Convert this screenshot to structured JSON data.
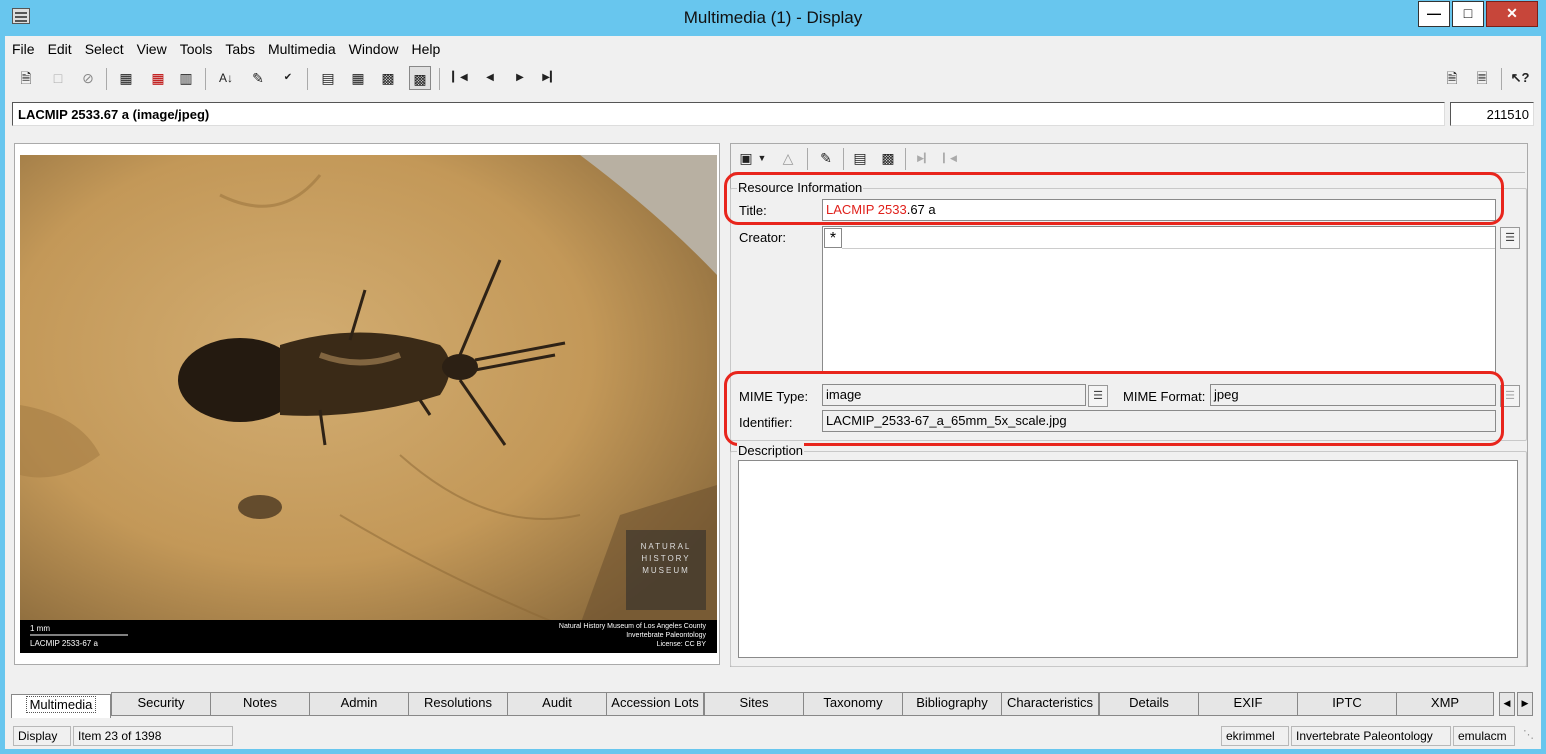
{
  "window": {
    "title": "Multimedia (1) - Display"
  },
  "menu": [
    "File",
    "Edit",
    "Select",
    "View",
    "Tools",
    "Tabs",
    "Multimedia",
    "Window",
    "Help"
  ],
  "record": {
    "summary": "LACMIP 2533.67 a (image/jpeg)",
    "id": "211510"
  },
  "image": {
    "scale_label": "1 mm",
    "caption": "LACMIP 2533-67 a",
    "credit_line1": "Natural History Museum of Los Angeles County",
    "credit_line2": "Invertebrate Paleontology",
    "credit_line3": "License: CC BY",
    "logo_text": [
      "NATURAL",
      "HISTORY",
      "MUSEUM"
    ]
  },
  "resource": {
    "group_label": "Resource Information",
    "title_label": "Title:",
    "title_highlight": "LACMIP 2533",
    "title_rest": ".67 a",
    "creator_label": "Creator:",
    "creator_marker": "*",
    "mime_type_label": "MIME Type:",
    "mime_type": "image",
    "mime_format_label": "MIME Format:",
    "mime_format": "jpeg",
    "identifier_label": "Identifier:",
    "identifier": "LACMIP_2533-67_a_65mm_5x_scale.jpg"
  },
  "description": {
    "label": "Description",
    "value": ""
  },
  "tabs": [
    "Multimedia",
    "Security",
    "Notes",
    "Admin",
    "Resolutions",
    "Audit",
    "Accession Lots",
    "Sites",
    "Taxonomy",
    "Bibliography",
    "Characteristics",
    "Details",
    "EXIF",
    "IPTC",
    "XMP"
  ],
  "active_tab": "Multimedia",
  "status": {
    "mode": "Display",
    "item": "Item 23 of 1398",
    "user": "ekrimmel",
    "department": "Invertebrate Paleontology",
    "host": "emulacm"
  },
  "colors": {
    "titlebar": "#68c6ee",
    "highlight_ring": "#e8251c",
    "title_highlight": "#e0201b",
    "close_button": "#c7463a"
  }
}
